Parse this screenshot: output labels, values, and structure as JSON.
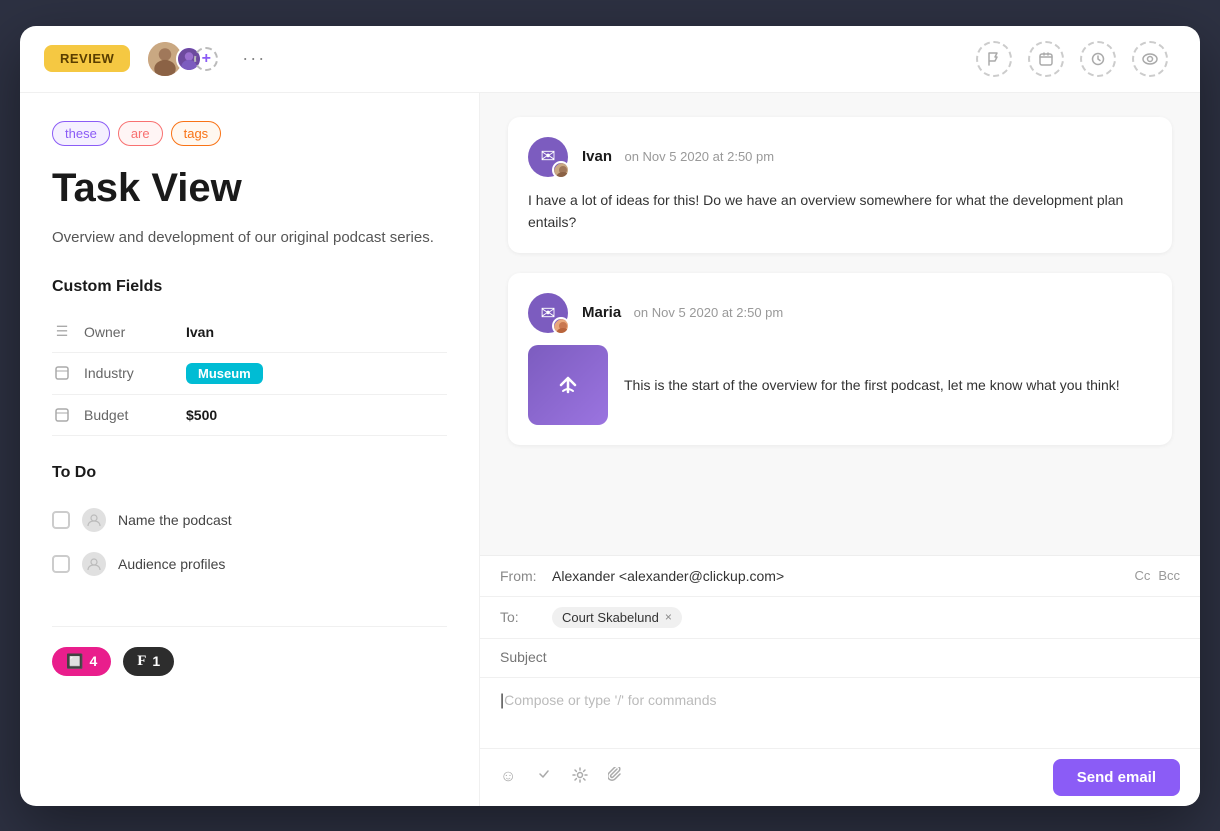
{
  "window": {
    "title": "Task View"
  },
  "topbar": {
    "review_label": "REVIEW",
    "more_btn": "···"
  },
  "toolbar": {
    "icons": [
      "flag-icon",
      "calendar-icon",
      "clock-icon",
      "eye-icon"
    ]
  },
  "left": {
    "tags": [
      {
        "label": "these",
        "class": "tag-these"
      },
      {
        "label": "are",
        "class": "tag-are"
      },
      {
        "label": "tags",
        "class": "tag-tags"
      }
    ],
    "title": "Task View",
    "description": "Overview and development of our original podcast series.",
    "custom_fields_title": "Custom Fields",
    "fields": [
      {
        "icon": "☰",
        "label": "Owner",
        "value": "Ivan",
        "type": "text"
      },
      {
        "icon": "⊟",
        "label": "Industry",
        "value": "Museum",
        "type": "badge"
      },
      {
        "icon": "⊟",
        "label": "Budget",
        "value": "$500",
        "type": "text"
      }
    ],
    "todo_title": "To Do",
    "todos": [
      {
        "label": "Name the podcast"
      },
      {
        "label": "Audience profiles"
      }
    ]
  },
  "bottom_pills": [
    {
      "icon": "🔲",
      "count": "4",
      "class": "pill-pink"
    },
    {
      "icon": "F",
      "count": "1",
      "class": "pill-dark"
    }
  ],
  "comments": [
    {
      "author": "Ivan",
      "time": "on Nov 5 2020 at 2:50 pm",
      "text": "I have a lot of ideas for this! Do we have an overview somewhere for what the development plan entails?",
      "has_attachment": false
    },
    {
      "author": "Maria",
      "time": "on Nov 5 2020 at 2:50 pm",
      "text": "This is the start of the overview for the first podcast, let me know what you think!",
      "has_attachment": true
    }
  ],
  "email": {
    "from_label": "From:",
    "from_value": "Alexander <alexander@clickup.com>",
    "cc_label": "Cc",
    "bcc_label": "Bcc",
    "to_label": "To:",
    "to_chip": "Court Skabelund",
    "subject_placeholder": "Subject",
    "body_placeholder": "Compose or type '/' for commands",
    "send_label": "Send email"
  }
}
